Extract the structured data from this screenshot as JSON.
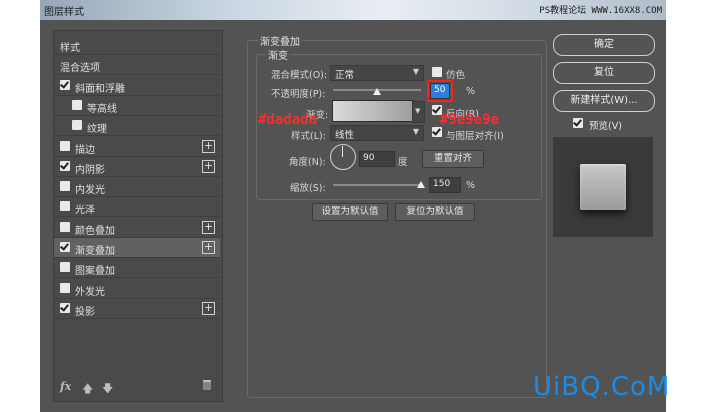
{
  "window": {
    "title": "图层样式",
    "watermark": "PS教程论坛 WWW.16XX8.COM"
  },
  "left_panel": {
    "items": [
      {
        "label": "样式",
        "checkbox": false,
        "checked": false,
        "plus": false,
        "indent": 0,
        "selected": false
      },
      {
        "label": "混合选项",
        "checkbox": false,
        "checked": false,
        "plus": false,
        "indent": 0,
        "selected": false
      },
      {
        "label": "斜面和浮雕",
        "checkbox": true,
        "checked": true,
        "plus": false,
        "indent": 0,
        "selected": false
      },
      {
        "label": "等高线",
        "checkbox": true,
        "checked": false,
        "plus": false,
        "indent": 1,
        "selected": false
      },
      {
        "label": "纹理",
        "checkbox": true,
        "checked": false,
        "plus": false,
        "indent": 1,
        "selected": false
      },
      {
        "label": "描边",
        "checkbox": true,
        "checked": false,
        "plus": true,
        "indent": 0,
        "selected": false
      },
      {
        "label": "内阴影",
        "checkbox": true,
        "checked": true,
        "plus": true,
        "indent": 0,
        "selected": false
      },
      {
        "label": "内发光",
        "checkbox": true,
        "checked": false,
        "plus": false,
        "indent": 0,
        "selected": false
      },
      {
        "label": "光泽",
        "checkbox": true,
        "checked": false,
        "plus": false,
        "indent": 0,
        "selected": false
      },
      {
        "label": "颜色叠加",
        "checkbox": true,
        "checked": false,
        "plus": true,
        "indent": 0,
        "selected": false
      },
      {
        "label": "渐变叠加",
        "checkbox": true,
        "checked": true,
        "plus": true,
        "indent": 0,
        "selected": true
      },
      {
        "label": "图案叠加",
        "checkbox": true,
        "checked": false,
        "plus": false,
        "indent": 0,
        "selected": false
      },
      {
        "label": "外发光",
        "checkbox": true,
        "checked": false,
        "plus": false,
        "indent": 0,
        "selected": false
      },
      {
        "label": "投影",
        "checkbox": true,
        "checked": true,
        "plus": true,
        "indent": 0,
        "selected": false
      }
    ],
    "fx_label": "fx",
    "icons": [
      "fx-icon",
      "arrow-up-icon",
      "arrow-down-icon",
      "trash-icon"
    ]
  },
  "gradient_overlay": {
    "section_title": "渐变叠加",
    "subsection_title": "渐变",
    "blend_mode_label": "混合模式(O):",
    "blend_mode_value": "正常",
    "dither_label": "仿色",
    "dither_checked": false,
    "opacity_label": "不透明度(P):",
    "opacity_value": "50",
    "opacity_percent": 50,
    "unit_percent": "%",
    "gradient_label": "渐变:",
    "reverse_label": "反向(R)",
    "reverse_checked": true,
    "style_label": "样式(L):",
    "style_value": "线性",
    "align_label": "与图层对齐(I)",
    "align_checked": true,
    "angle_label": "角度(N):",
    "angle_value": "90",
    "angle_unit": "度",
    "reset_align_button": "重置对齐",
    "scale_label": "缩放(S):",
    "scale_value": "150",
    "scale_percent": 150,
    "set_default_button": "设置为默认值",
    "reset_default_button": "复位为默认值",
    "annotation_left": "#dadada",
    "annotation_right": "#9e9e9e",
    "gradient_start_color": "#dadada",
    "gradient_end_color": "#9e9e9e"
  },
  "right_panel": {
    "ok_button": "确定",
    "reset_button": "复位",
    "new_style_button": "新建样式(W)...",
    "preview_label": "预览(V)",
    "preview_checked": true
  },
  "logo": {
    "text": "UiBQ.CoM"
  },
  "colors": {
    "dialog_bg": "#535353",
    "annotation": "#ff2d2d",
    "logo": "#1a8ce8",
    "highlight": "#2b7fd8"
  }
}
